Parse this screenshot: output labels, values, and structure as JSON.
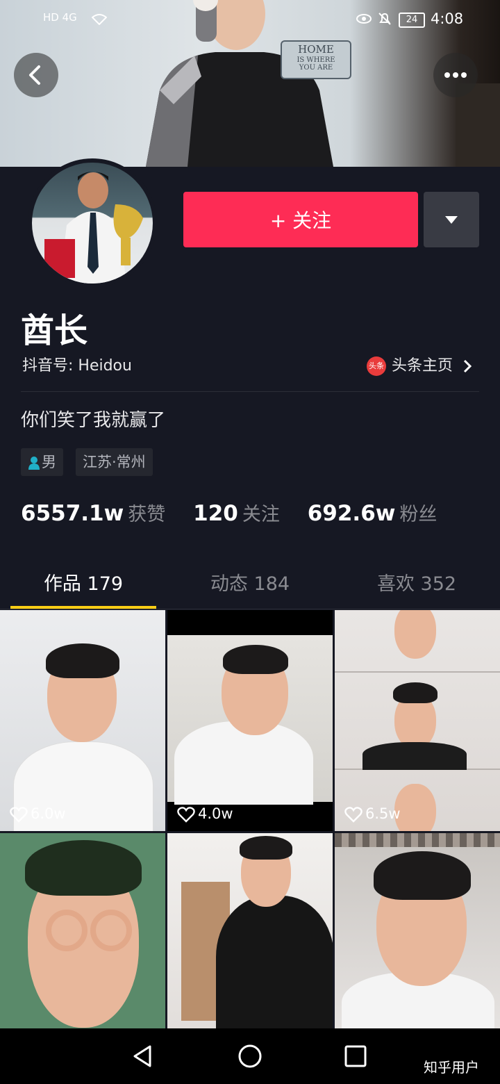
{
  "status_bar": {
    "left": "HD 4G",
    "battery": "24",
    "time": "4:08"
  },
  "cover": {
    "sign_line1": "HOME",
    "sign_line2": "IS WHERE",
    "sign_line3": "YOU ARE"
  },
  "profile": {
    "nickname": "酋长",
    "douyin_id": "抖音号: Heidou",
    "toutiao_logo_text": "头条",
    "toutiao_label": "头条主页",
    "bio": "你们笑了我就赢了",
    "tag_gender": "男",
    "tag_location": "江苏·常州",
    "follow_label": "+ 关注"
  },
  "stats": {
    "likes_count": "6557.1w",
    "likes_label": "获赞",
    "following_count": "120",
    "following_label": "关注",
    "followers_count": "692.6w",
    "followers_label": "粉丝"
  },
  "tabs": [
    {
      "label": "作品 179"
    },
    {
      "label": "动态 184"
    },
    {
      "label": "喜欢 352"
    }
  ],
  "videos": [
    {
      "likes": "6.0w"
    },
    {
      "likes": "4.0w"
    },
    {
      "likes": "6.5w"
    },
    {
      "likes": ""
    },
    {
      "likes": ""
    },
    {
      "likes": ""
    }
  ],
  "watermark": "知乎用户",
  "colors": {
    "background": "#161823",
    "follow": "#fe2c55",
    "tab_indicator": "#face15"
  }
}
